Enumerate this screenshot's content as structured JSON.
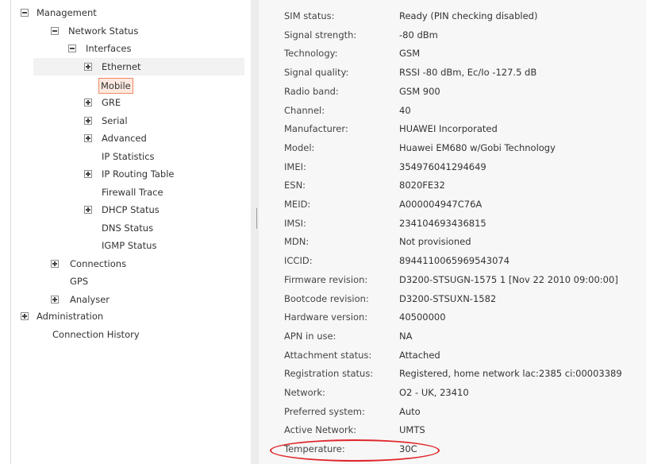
{
  "tree": {
    "items": [
      {
        "label": "Management",
        "toggle": "minus"
      },
      {
        "label": "Network Status",
        "toggle": "minus"
      },
      {
        "label": "Interfaces",
        "toggle": "minus"
      },
      {
        "label": "Ethernet",
        "toggle": "plus"
      },
      {
        "label": "Mobile",
        "toggle": "none",
        "selected": true
      },
      {
        "label": "GRE",
        "toggle": "plus"
      },
      {
        "label": "Serial",
        "toggle": "plus"
      },
      {
        "label": "Advanced",
        "toggle": "plus"
      },
      {
        "label": "IP Statistics",
        "toggle": "none"
      },
      {
        "label": "IP Routing Table",
        "toggle": "plus"
      },
      {
        "label": "Firewall Trace",
        "toggle": "none"
      },
      {
        "label": "DHCP Status",
        "toggle": "plus"
      },
      {
        "label": "DNS Status",
        "toggle": "none"
      },
      {
        "label": "IGMP Status",
        "toggle": "none"
      },
      {
        "label": "Connections",
        "toggle": "plus"
      },
      {
        "label": "GPS",
        "toggle": "none"
      },
      {
        "label": "Analyser",
        "toggle": "plus"
      },
      {
        "label": "Administration",
        "toggle": "plus"
      },
      {
        "label": "Connection History",
        "toggle": "none"
      }
    ]
  },
  "details": {
    "rows": [
      {
        "label": "SIM status:",
        "value": "Ready (PIN checking disabled)"
      },
      {
        "label": "Signal strength:",
        "value": "-80 dBm"
      },
      {
        "label": "Technology:",
        "value": "GSM"
      },
      {
        "label": "Signal quality:",
        "value": "RSSI -80 dBm, Ec/Io -127.5 dB"
      },
      {
        "label": "Radio band:",
        "value": "GSM 900"
      },
      {
        "label": "Channel:",
        "value": "40"
      },
      {
        "label": "Manufacturer:",
        "value": "HUAWEI Incorporated"
      },
      {
        "label": "Model:",
        "value": "Huawei EM680 w/Gobi Technology"
      },
      {
        "label": "IMEI:",
        "value": "354976041294649"
      },
      {
        "label": "ESN:",
        "value": "8020FE32"
      },
      {
        "label": "MEID:",
        "value": "A000004947C76A"
      },
      {
        "label": "IMSI:",
        "value": "234104693436815"
      },
      {
        "label": "MDN:",
        "value": "Not provisioned"
      },
      {
        "label": "ICCID:",
        "value": "8944110065969543074"
      },
      {
        "label": "Firmware revision:",
        "value": "D3200-STSUGN-1575 1 [Nov 22 2010 09:00:00]"
      },
      {
        "label": "Bootcode revision:",
        "value": "D3200-STSUXN-1582"
      },
      {
        "label": "Hardware version:",
        "value": "40500000"
      },
      {
        "label": "APN in use:",
        "value": "NA"
      },
      {
        "label": "Attachment status:",
        "value": "Attached"
      },
      {
        "label": "Registration status:",
        "value": "Registered, home network lac:2385 ci:00003389"
      },
      {
        "label": "Network:",
        "value": "O2 - UK, 23410"
      },
      {
        "label": "Preferred system:",
        "value": "Auto"
      },
      {
        "label": "Active Network:",
        "value": "UMTS"
      },
      {
        "label": "Temperature:",
        "value": "30C"
      }
    ]
  },
  "colors": {
    "selection_border": "#f08a63",
    "annotation": "#e0262b"
  }
}
